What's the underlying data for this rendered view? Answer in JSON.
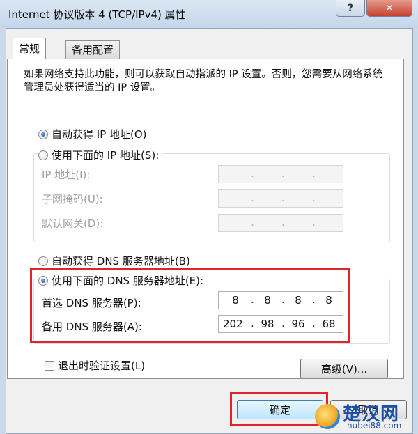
{
  "window": {
    "title": "Internet 协议版本 4 (TCP/IPv4) 属性",
    "help_label": "?",
    "close_label": "✕"
  },
  "tabs": [
    {
      "label": "常规"
    },
    {
      "label": "备用配置"
    }
  ],
  "description": "如果网络支持此功能，则可以获取自动指派的 IP 设置。否则，您需要从网络系统管理员处获得适当的 IP 设置。",
  "ip": {
    "auto_label": "自动获得 IP 地址(O)",
    "manual_label": "使用下面的 IP 地址(S):",
    "auto_checked": true,
    "address_label": "IP 地址(I):",
    "subnet_label": "子网掩码(U):",
    "gateway_label": "默认网关(D):"
  },
  "dns": {
    "auto_label": "自动获得 DNS 服务器地址(B)",
    "manual_label": "使用下面的 DNS 服务器地址(E):",
    "manual_checked": true,
    "preferred_label": "首选 DNS 服务器(P):",
    "preferred_octets": [
      "8",
      "8",
      "8",
      "8"
    ],
    "alternate_label": "备用 DNS 服务器(A):",
    "alternate_octets": [
      "202",
      "98",
      "96",
      "68"
    ]
  },
  "validate_label": "退出时验证设置(L)",
  "advanced_label": "高级(V)...",
  "ok_label": "确定",
  "cancel_label": "取消",
  "watermark": {
    "text": "楚汉网",
    "url": "hubei88.com"
  },
  "colors": {
    "highlight_box": "#e0242d",
    "radio_fill": "#1a4f9c",
    "titlebar": "#c4d6ea"
  }
}
